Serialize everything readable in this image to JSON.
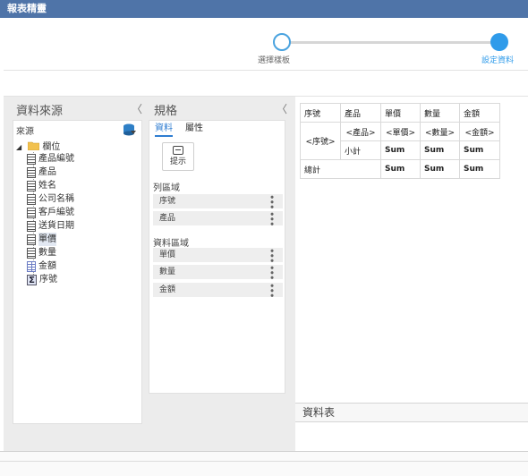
{
  "window": {
    "title": "報表精靈"
  },
  "wizard": {
    "step1_label": "選擇樣板",
    "step2_label": "設定資料",
    "active_color": "#2f9bea"
  },
  "datasource": {
    "header": "資料來源",
    "collapse_icon": "〈",
    "source_label": "來源",
    "root": "欄位",
    "fields": [
      {
        "label": "產品編號",
        "icon": "field-icon"
      },
      {
        "label": "產品",
        "icon": "field-icon"
      },
      {
        "label": "姓名",
        "icon": "field-icon"
      },
      {
        "label": "公司名稱",
        "icon": "field-icon"
      },
      {
        "label": "客戶編號",
        "icon": "field-icon"
      },
      {
        "label": "送貨日期",
        "icon": "field-icon"
      },
      {
        "label": "單價",
        "icon": "field-icon"
      },
      {
        "label": "數量",
        "icon": "field-icon"
      },
      {
        "label": "金額",
        "icon": "calc-field-icon"
      },
      {
        "label": "序號",
        "icon": "sigma-icon"
      }
    ]
  },
  "spec": {
    "header": "規格",
    "collapse_icon": "〈",
    "tabs": [
      "資料",
      "屬性"
    ],
    "hint_label": "提示",
    "row_section_label": "列區域",
    "row_items": [
      "序號",
      "產品"
    ],
    "data_section_label": "資料區域",
    "data_items": [
      "單價",
      "數量",
      "金額"
    ]
  },
  "report": {
    "header_row": [
      "序號",
      "產品",
      "單價",
      "數量",
      "金額"
    ],
    "row2": {
      "group": "<序號>",
      "product": "<產品>",
      "price": "<單價>",
      "qty": "<數量>",
      "amount": "<金額>"
    },
    "row3": {
      "label": "小計",
      "price": "Sum",
      "qty": "Sum",
      "amount": "Sum"
    },
    "row4": {
      "label": "總計",
      "price": "Sum",
      "qty": "Sum",
      "amount": "Sum"
    }
  },
  "sheet": {
    "header": "資料表"
  }
}
